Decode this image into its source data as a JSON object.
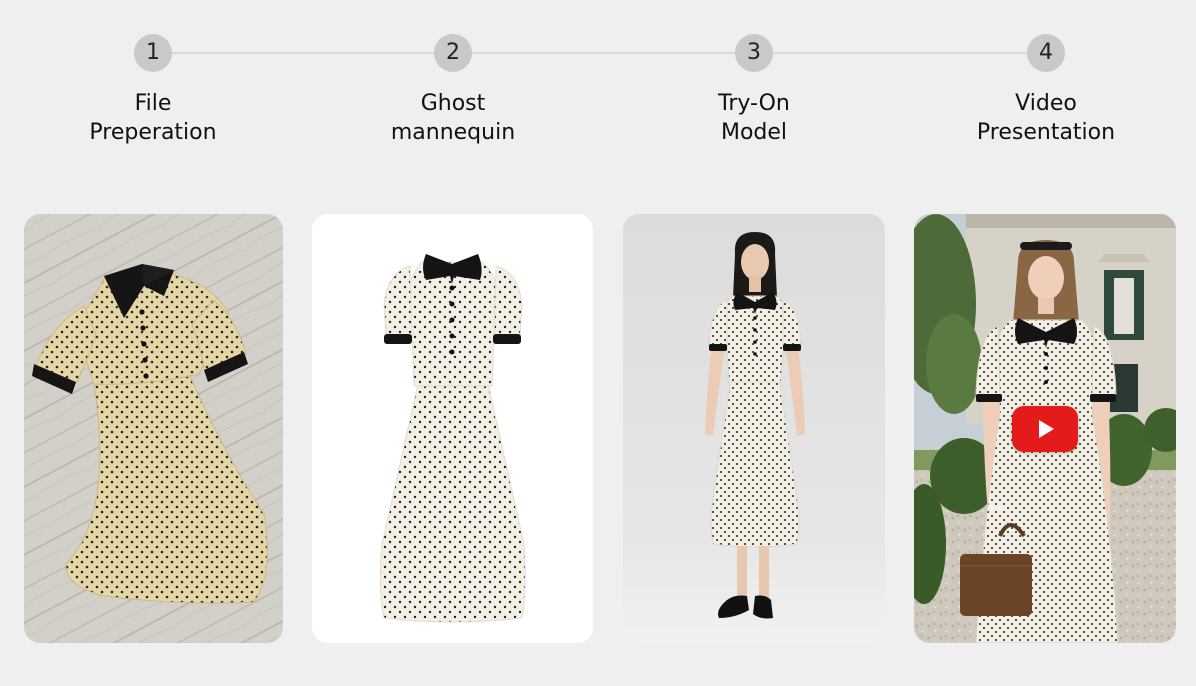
{
  "steps": [
    {
      "number": "1",
      "label_line1": "File",
      "label_line2": "Preperation"
    },
    {
      "number": "2",
      "label_line1": "Ghost",
      "label_line2": "mannequin"
    },
    {
      "number": "3",
      "label_line1": "Try-On",
      "label_line2": "Model"
    },
    {
      "number": "4",
      "label_line1": "Video",
      "label_line2": "Presentation"
    }
  ],
  "cards": [
    {
      "name": "flat-lay-dress-photo"
    },
    {
      "name": "ghost-mannequin-dress-photo"
    },
    {
      "name": "studio-model-dress-photo"
    },
    {
      "name": "outdoor-video-thumbnail",
      "play_icon": "youtube-play-icon"
    }
  ],
  "colors": {
    "page_background": "#efefef",
    "step_circle": "#c9c9c9",
    "step_line": "#d8d8d8",
    "play_button": "#e31b1b"
  }
}
